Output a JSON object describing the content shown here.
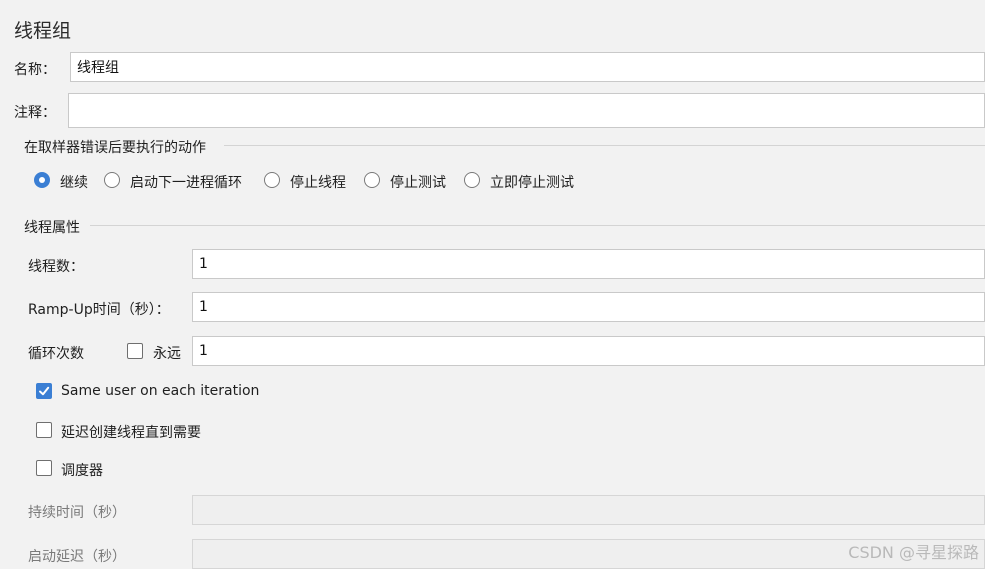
{
  "panel": {
    "title": "线程组"
  },
  "name": {
    "label": "名称：",
    "value": "线程组"
  },
  "comment": {
    "label": "注释：",
    "value": ""
  },
  "error_action": {
    "heading": "在取样器错误后要执行的动作",
    "options": [
      "继续",
      "启动下一进程循环",
      "停止线程",
      "停止测试",
      "立即停止测试"
    ],
    "selected": "继续"
  },
  "thread_props": {
    "heading": "线程属性",
    "threads_label": "线程数：",
    "threads_value": "1",
    "rampup_label": "Ramp-Up时间（秒）：",
    "rampup_value": "1",
    "loop_label": "循环次数",
    "forever_label": "永远",
    "forever_checked": false,
    "loop_value": "1",
    "same_user_label": "Same user on each iteration",
    "same_user_checked": true,
    "delay_label": "延迟创建线程直到需要",
    "delay_checked": false,
    "scheduler_label": "调度器",
    "scheduler_checked": false,
    "duration_label": "持续时间（秒）",
    "duration_value": "",
    "startup_delay_label": "启动延迟（秒）",
    "startup_delay_value": ""
  },
  "watermark": "CSDN @寻星探路",
  "colors": {
    "accent": "#3b7fd4",
    "background": "#f2f2f2"
  }
}
